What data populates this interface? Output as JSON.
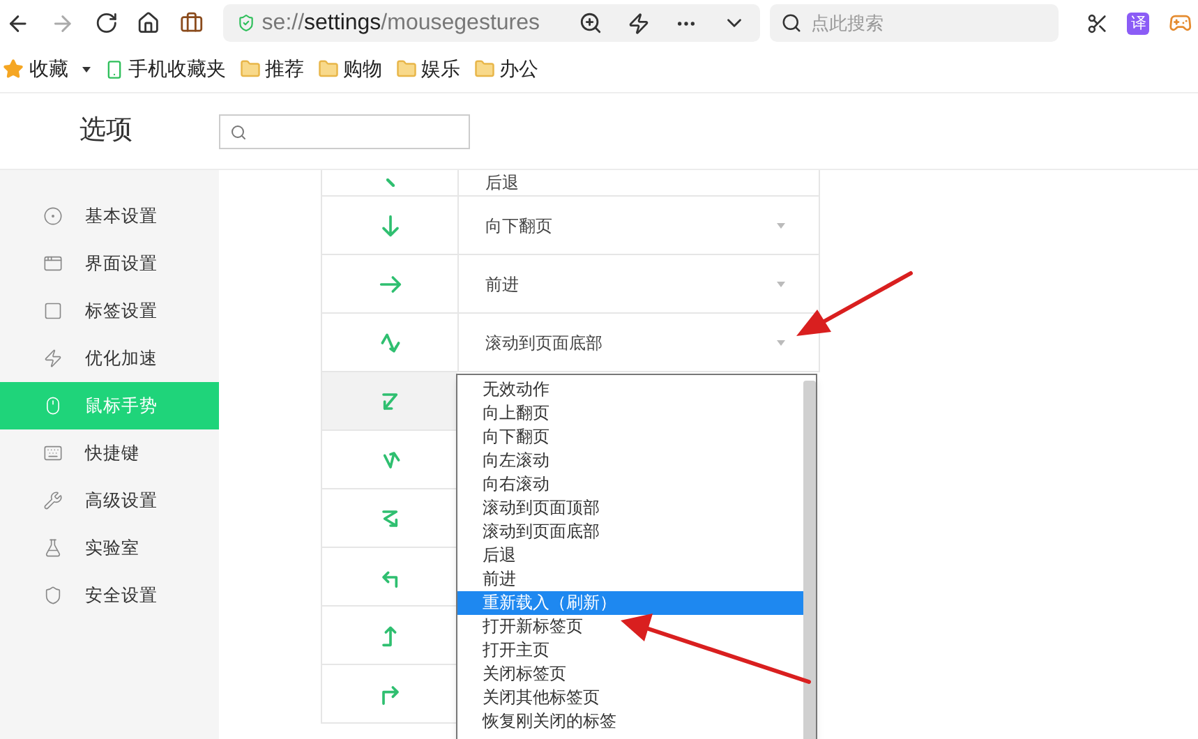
{
  "browser_toolbar": {
    "address": {
      "scheme": "se://",
      "host": "settings",
      "path": "/mousegestures"
    },
    "search": {
      "placeholder": "点此搜索"
    },
    "translate_badge": "译"
  },
  "bookmarks_bar": {
    "favorites": "收藏",
    "items": [
      {
        "kind": "phone",
        "label": "手机收藏夹"
      },
      {
        "kind": "folder",
        "label": "推荐"
      },
      {
        "kind": "folder",
        "label": "购物"
      },
      {
        "kind": "folder",
        "label": "娱乐"
      },
      {
        "kind": "folder",
        "label": "办公"
      }
    ]
  },
  "page": {
    "title": "选项"
  },
  "sidebar": {
    "items": [
      {
        "label": "基本设置",
        "selected": false
      },
      {
        "label": "界面设置",
        "selected": false
      },
      {
        "label": "标签设置",
        "selected": false
      },
      {
        "label": "优化加速",
        "selected": false
      },
      {
        "label": "鼠标手势",
        "selected": true
      },
      {
        "label": "快捷键",
        "selected": false
      },
      {
        "label": "高级设置",
        "selected": false
      },
      {
        "label": "实验室",
        "selected": false
      },
      {
        "label": "安全设置",
        "selected": false
      }
    ]
  },
  "gestures": [
    {
      "action": "后退",
      "selected": false
    },
    {
      "action": "向下翻页",
      "selected": false
    },
    {
      "action": "前进",
      "selected": false
    },
    {
      "action": "滚动到页面底部",
      "selected": false
    },
    {
      "selected": true
    },
    {
      "selected": false
    },
    {
      "selected": false
    },
    {
      "selected": false
    },
    {
      "selected": false
    },
    {
      "selected": false
    }
  ],
  "dropdown": {
    "options": [
      {
        "label": "无效动作",
        "selected": false
      },
      {
        "label": "向上翻页",
        "selected": false
      },
      {
        "label": "向下翻页",
        "selected": false
      },
      {
        "label": "向左滚动",
        "selected": false
      },
      {
        "label": "向右滚动",
        "selected": false
      },
      {
        "label": "滚动到页面顶部",
        "selected": false
      },
      {
        "label": "滚动到页面底部",
        "selected": false
      },
      {
        "label": "后退",
        "selected": false
      },
      {
        "label": "前进",
        "selected": false
      },
      {
        "label": "重新载入（刷新）",
        "selected": true
      },
      {
        "label": "打开新标签页",
        "selected": false
      },
      {
        "label": "打开主页",
        "selected": false
      },
      {
        "label": "关闭标签页",
        "selected": false
      },
      {
        "label": "关闭其他标签页",
        "selected": false
      },
      {
        "label": "恢复刚关闭的标签",
        "selected": false
      }
    ]
  }
}
